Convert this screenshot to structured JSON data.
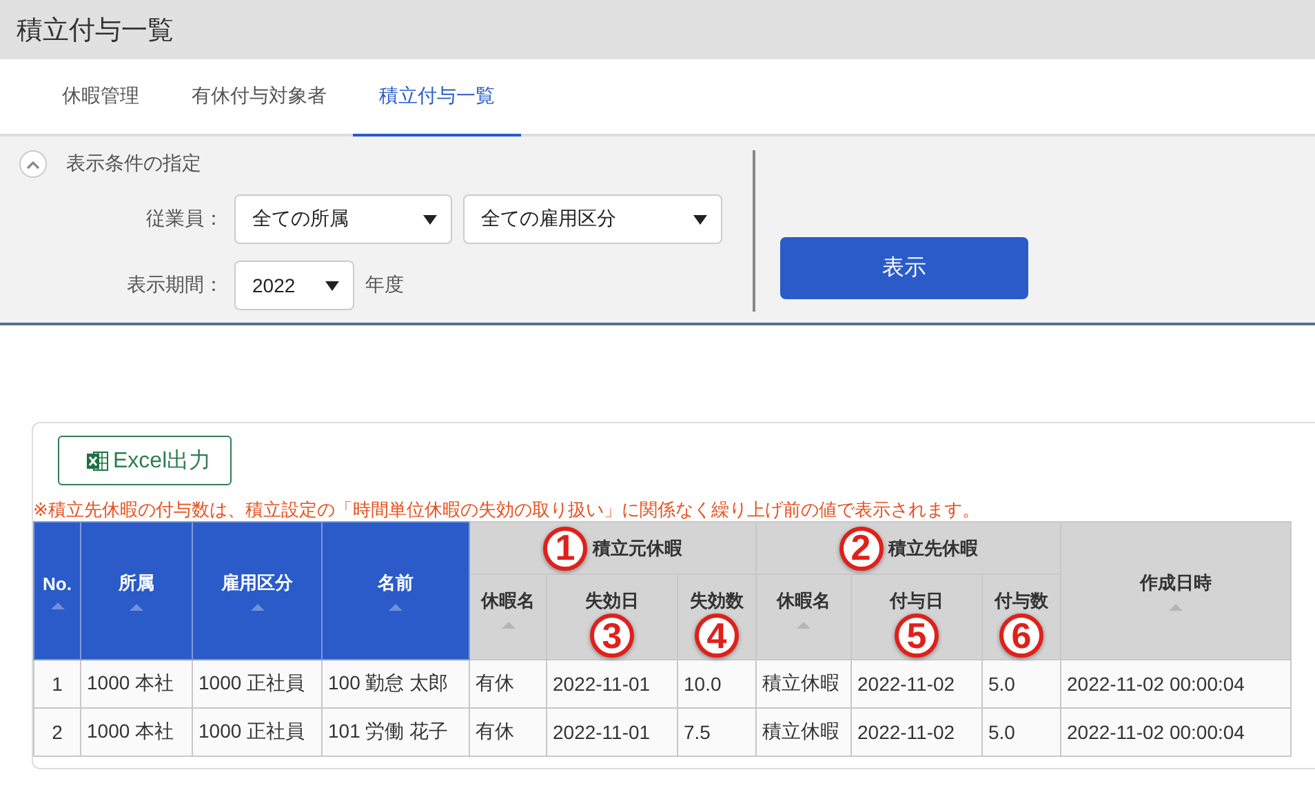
{
  "page_title": "積立付与一覧",
  "tabs": [
    {
      "label": "休暇管理",
      "selected": false
    },
    {
      "label": "有休付与対象者",
      "selected": false
    },
    {
      "label": "積立付与一覧",
      "selected": true
    }
  ],
  "filter": {
    "title": "表示条件の指定",
    "expanded": true,
    "employee_label": "従業員：",
    "department": "全ての所属",
    "employment_type": "全ての雇用区分",
    "period_label": "表示期間：",
    "year": "2022",
    "year_unit": "年度",
    "show_button": "表示"
  },
  "export_button": "Excel出力",
  "note": "※積立先休暇の付与数は、積立設定の「時間単位休暇の失効の取り扱い」に関係なく繰り上げ前の値で表示されます。",
  "table": {
    "columns": [
      {
        "label": "No.",
        "kind": "key",
        "sortable": true
      },
      {
        "label": "所属",
        "kind": "key",
        "sortable": true
      },
      {
        "label": "雇用区分",
        "kind": "key",
        "sortable": true
      },
      {
        "label": "名前",
        "kind": "key",
        "sortable": true
      },
      {
        "kind": "group",
        "label": "積立元休暇",
        "callout": "1",
        "colspan": 3,
        "children": [
          {
            "label": "休暇名",
            "sortable": true
          },
          {
            "label": "失効日",
            "callout": "3"
          },
          {
            "label": "失効数",
            "callout": "4"
          }
        ]
      },
      {
        "kind": "group",
        "label": "積立先休暇",
        "callout": "2",
        "colspan": 3,
        "children": [
          {
            "label": "休暇名",
            "sortable": true
          },
          {
            "label": "付与日",
            "callout": "5"
          },
          {
            "label": "付与数",
            "callout": "6"
          }
        ]
      },
      {
        "label": "作成日時",
        "kind": "plain",
        "sortable": true
      }
    ],
    "rows": [
      [
        "1",
        "1000 本社",
        "1000 正社員",
        "100 勤怠 太郎",
        "有休",
        "2022-11-01",
        "10.0",
        "積立休暇",
        "2022-11-02",
        "5.0",
        "2022-11-02 00:00:04"
      ],
      [
        "2",
        "1000 本社",
        "1000 正社員",
        "101 労働 花子",
        "有休",
        "2022-11-01",
        "7.5",
        "積立休暇",
        "2022-11-02",
        "5.0",
        "2022-11-02 00:00:04"
      ]
    ]
  }
}
